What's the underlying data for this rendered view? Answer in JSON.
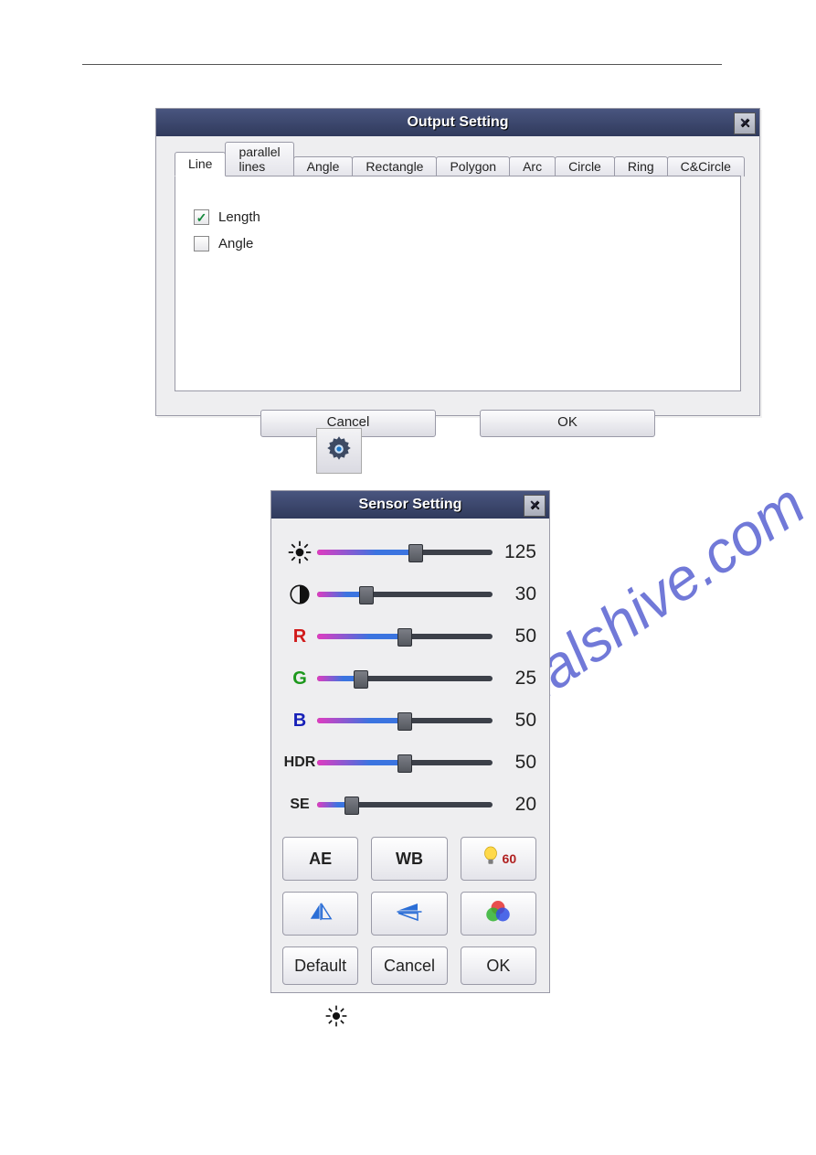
{
  "watermark": "manualshive.com",
  "output_dialog": {
    "title": "Output Setting",
    "tabs": [
      "Line",
      "parallel lines",
      "Angle",
      "Rectangle",
      "Polygon",
      "Arc",
      "Circle",
      "Ring",
      "C&Circle"
    ],
    "active_tab_index": 0,
    "line_tab": {
      "length_label": "Length",
      "length_checked": true,
      "angle_label": "Angle",
      "angle_checked": false
    },
    "cancel": "Cancel",
    "ok": "OK"
  },
  "sensor_dialog": {
    "title": "Sensor Setting",
    "sliders": {
      "brightness": {
        "label_icon": "brightness",
        "value": 125,
        "pct": 56
      },
      "contrast": {
        "label_icon": "contrast",
        "value": 30,
        "pct": 28
      },
      "r": {
        "label": "R",
        "value": 50,
        "pct": 50
      },
      "g": {
        "label": "G",
        "value": 25,
        "pct": 25
      },
      "b": {
        "label": "B",
        "value": 50,
        "pct": 50
      },
      "hdr": {
        "label": "HDR",
        "value": 50,
        "pct": 50
      },
      "se": {
        "label": "SE",
        "value": 20,
        "pct": 20
      }
    },
    "buttons": {
      "ae": "AE",
      "wb": "WB",
      "light_freq": "60",
      "flip_h_icon": "flip-horizontal",
      "flip_v_icon": "flip-vertical",
      "color_icon": "rgb-circles",
      "default": "Default",
      "cancel": "Cancel",
      "ok": "OK"
    }
  }
}
